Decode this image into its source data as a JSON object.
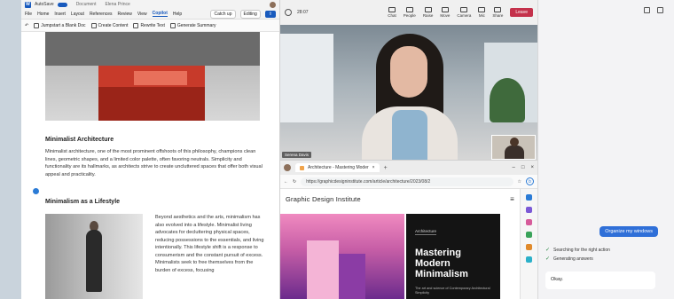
{
  "word": {
    "app_name": "AutoSave",
    "doc_title": "Document",
    "account": "Elena Prince",
    "menu": [
      "File",
      "Home",
      "Insert",
      "Layout",
      "References",
      "Review",
      "View",
      "Copilot",
      "Help"
    ],
    "menu_active": "Copilot",
    "catch_up": "Catch up",
    "editing": "Editing",
    "toolbar": {
      "jumpstart": "Jumpstart a Blank Doc",
      "create": "Create Content",
      "rewrite": "Rewrite Text",
      "summary": "Generate Summary"
    },
    "heading1": "Minimalist Architecture",
    "para1": "Minimalist architecture, one of the most prominent offshoots of this philosophy, champions clean lines, geometric shapes, and a limited color palette, often favoring neutrals. Simplicity and functionality are its hallmarks, as architects strive to create uncluttered spaces that offer both visual appeal and practicality.",
    "heading2": "Minimalism as a Lifestyle",
    "para2": "Beyond aesthetics and the arts, minimalism has also evolved into a lifestyle. Minimalist living advocates for decluttering physical spaces, reducing possessions to the essentials, and living intentionally. This lifestyle shift is a response to consumerism and the constant pursuit of excess. Minimalists seek to free themselves from the burden of excess, focusing"
  },
  "teams": {
    "timer": "28:07",
    "controls": [
      "Chat",
      "People",
      "Raise",
      "Move",
      "Camera",
      "Mic",
      "Share"
    ],
    "leave": "Leave",
    "speaker": "Serena Davis"
  },
  "edge": {
    "tab_title": "Architecture - Mastering Moder",
    "url": "https://graphicdesigninstitute.com/article/architecture/2023/08/2",
    "site_name": "Graphic Design Institute",
    "hero_tag": "Architecture",
    "hero_title": "Mastering Modern Minimalism",
    "hero_sub": "The art and science of Contemporary Architectural Simplicity"
  },
  "copilot": {
    "prompt": "Organize my windows",
    "steps": [
      "Searching for the right action",
      "Generating answers"
    ],
    "reply": "Okay."
  },
  "colors": {
    "word_blue": "#185abd",
    "teams_leave": "#c4314b",
    "copilot_prompt": "#2f6fd8"
  }
}
